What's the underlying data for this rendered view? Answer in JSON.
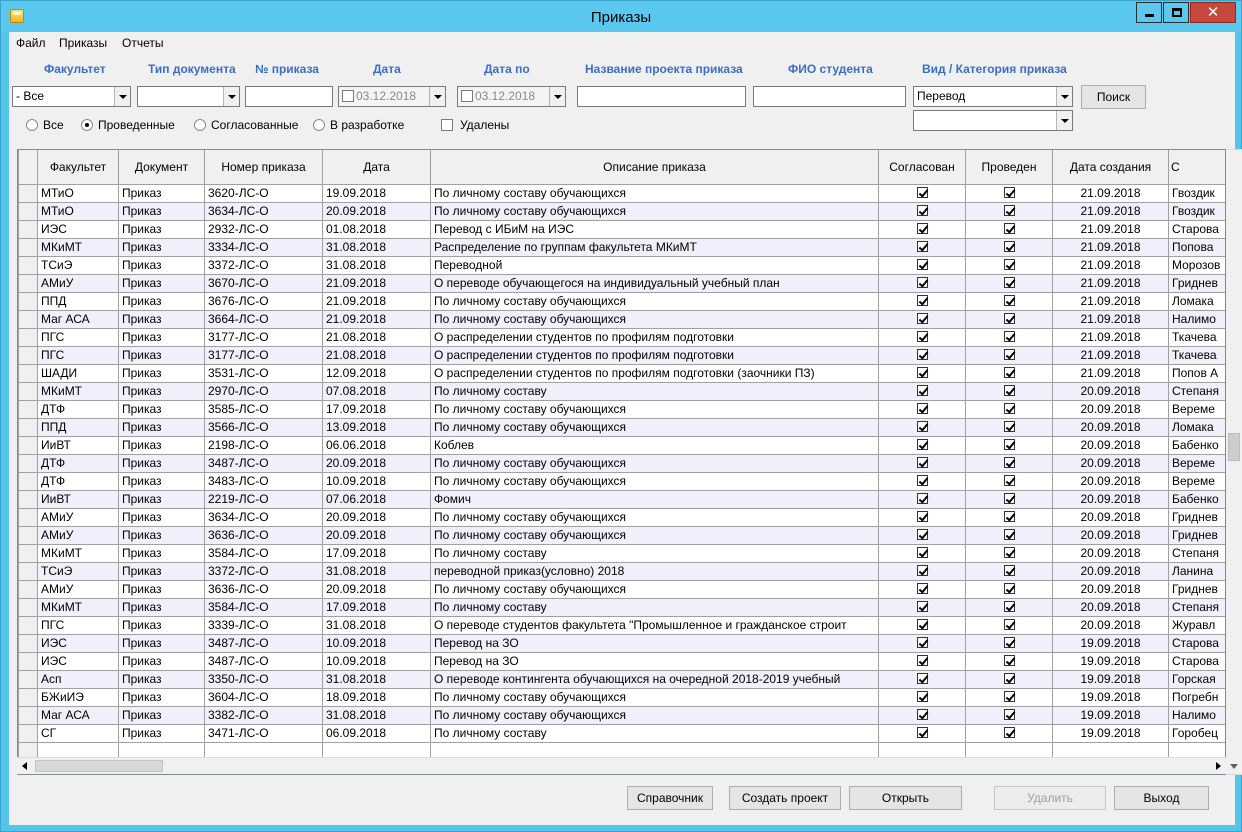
{
  "window": {
    "title": "Приказы"
  },
  "menu": [
    "Файл",
    "Приказы",
    "Отчеты"
  ],
  "filters": {
    "labels": {
      "faculty": "Факультет",
      "doc_type": "Тип документа",
      "order_no": "№ приказа",
      "date": "Дата",
      "date_to": "Дата по",
      "project_name": "Название проекта приказа",
      "student_name": "ФИО студента",
      "category": "Вид / Категория приказа"
    },
    "faculty_value": "- Все",
    "doc_type_value": "",
    "order_no_value": "",
    "date_value": "03.12.2018",
    "date_to_value": "03.12.2018",
    "project_name_value": "",
    "student_name_value": "",
    "category_value": "Перевод",
    "subcategory_value": "",
    "search_button": "Поиск"
  },
  "status_filter": {
    "options": [
      "Все",
      "Проведенные",
      "Согласованные",
      "В разработке"
    ],
    "selected": "Проведенные",
    "deleted_label": "Удалены"
  },
  "table": {
    "columns": [
      "Факультет",
      "Документ",
      "Номер приказа",
      "Дата",
      "Описание приказа",
      "Согласован",
      "Проведен",
      "Дата создания",
      "С"
    ],
    "rows": [
      [
        "МТиО",
        "Приказ",
        "3620-ЛС-О",
        "19.09.2018",
        "По личному составу обучающихся",
        true,
        true,
        "21.09.2018",
        "Гвоздик"
      ],
      [
        "МТиО",
        "Приказ",
        "3634-ЛС-О",
        "20.09.2018",
        "По личному составу обучающихся",
        true,
        true,
        "21.09.2018",
        "Гвоздик"
      ],
      [
        "ИЭС",
        "Приказ",
        "2932-ЛС-О",
        "01.08.2018",
        "Перевод с ИБиМ на ИЭС",
        true,
        true,
        "21.09.2018",
        "Старова"
      ],
      [
        "МКиМТ",
        "Приказ",
        "3334-ЛС-О",
        "31.08.2018",
        "Распределение по группам факультета МКиМТ",
        true,
        true,
        "21.09.2018",
        "Попова"
      ],
      [
        "ТСиЭ",
        "Приказ",
        "3372-ЛС-О",
        "31.08.2018",
        "Переводной",
        true,
        true,
        "21.09.2018",
        "Морозов"
      ],
      [
        "АМиУ",
        "Приказ",
        "3670-ЛС-О",
        "21.09.2018",
        "О переводе обучающегося на индивидуальный учебный план",
        true,
        true,
        "21.09.2018",
        "Гриднев"
      ],
      [
        "ППД",
        "Приказ",
        "3676-ЛС-О",
        "21.09.2018",
        "По личному составу обучающихся",
        true,
        true,
        "21.09.2018",
        "Ломака"
      ],
      [
        "Маг АСА",
        "Приказ",
        "3664-ЛС-О",
        "21.09.2018",
        "По личному составу обучающихся",
        true,
        true,
        "21.09.2018",
        "Налимо"
      ],
      [
        "ПГС",
        "Приказ",
        "3177-ЛС-О",
        "21.08.2018",
        "О распределении студентов по профилям подготовки",
        true,
        true,
        "21.09.2018",
        "Ткачева"
      ],
      [
        "ПГС",
        "Приказ",
        "3177-ЛС-О",
        "21.08.2018",
        "О распределении студентов по профилям подготовки",
        true,
        true,
        "21.09.2018",
        "Ткачева"
      ],
      [
        "ШАДИ",
        "Приказ",
        "3531-ЛС-О",
        "12.09.2018",
        "О распределении студентов по профилям подготовки (заочники ПЗ)",
        true,
        true,
        "21.09.2018",
        "Попов А"
      ],
      [
        "МКиМТ",
        "Приказ",
        "2970-ЛС-О",
        "07.08.2018",
        "По личному составу",
        true,
        true,
        "20.09.2018",
        "Степаня"
      ],
      [
        "ДТФ",
        "Приказ",
        "3585-ЛС-О",
        "17.09.2018",
        "По личному составу обучающихся",
        true,
        true,
        "20.09.2018",
        "Вереме"
      ],
      [
        "ППД",
        "Приказ",
        "3566-ЛС-О",
        "13.09.2018",
        "По личному составу обучающихся",
        true,
        true,
        "20.09.2018",
        "Ломака"
      ],
      [
        "ИиВТ",
        "Приказ",
        "2198-ЛС-О",
        "06.06.2018",
        "Коблев",
        true,
        true,
        "20.09.2018",
        "Бабенко"
      ],
      [
        "ДТФ",
        "Приказ",
        "3487-ЛС-О",
        "20.09.2018",
        "По личному составу обучающихся",
        true,
        true,
        "20.09.2018",
        "Вереме"
      ],
      [
        "ДТФ",
        "Приказ",
        "3483-ЛС-О",
        "10.09.2018",
        "По личному составу обучающихся",
        true,
        true,
        "20.09.2018",
        "Вереме"
      ],
      [
        "ИиВТ",
        "Приказ",
        "2219-ЛС-О",
        "07.06.2018",
        "Фомич",
        true,
        true,
        "20.09.2018",
        "Бабенко"
      ],
      [
        "АМиУ",
        "Приказ",
        "3634-ЛС-О",
        "20.09.2018",
        "По личному составу обучающихся",
        true,
        true,
        "20.09.2018",
        "Гриднев"
      ],
      [
        "АМиУ",
        "Приказ",
        "3636-ЛС-О",
        "20.09.2018",
        "По личному составу обучающихся",
        true,
        true,
        "20.09.2018",
        "Гриднев"
      ],
      [
        "МКиМТ",
        "Приказ",
        "3584-ЛС-О",
        "17.09.2018",
        "По личному составу",
        true,
        true,
        "20.09.2018",
        "Степаня"
      ],
      [
        "ТСиЭ",
        "Приказ",
        "3372-ЛС-О",
        "31.08.2018",
        "переводной приказ(условно) 2018",
        true,
        true,
        "20.09.2018",
        "Ланина"
      ],
      [
        "АМиУ",
        "Приказ",
        "3636-ЛС-О",
        "20.09.2018",
        "По личному составу обучающихся",
        true,
        true,
        "20.09.2018",
        "Гриднев"
      ],
      [
        "МКиМТ",
        "Приказ",
        "3584-ЛС-О",
        "17.09.2018",
        "По личному составу",
        true,
        true,
        "20.09.2018",
        "Степаня"
      ],
      [
        "ПГС",
        "Приказ",
        "3339-ЛС-О",
        "31.08.2018",
        "О переводе студентов факультета \"Промышленное и гражданское строит",
        true,
        true,
        "20.09.2018",
        "Журавл"
      ],
      [
        "ИЭС",
        "Приказ",
        "3487-ЛС-О",
        "10.09.2018",
        "Перевод на ЗО",
        true,
        true,
        "19.09.2018",
        "Старова"
      ],
      [
        "ИЭС",
        "Приказ",
        "3487-ЛС-О",
        "10.09.2018",
        "Перевод на ЗО",
        true,
        true,
        "19.09.2018",
        "Старова"
      ],
      [
        "Асп",
        "Приказ",
        "3350-ЛС-О",
        "31.08.2018",
        "О переводе контингента обучающихся на очередной 2018-2019 учебный",
        true,
        true,
        "19.09.2018",
        "Горская"
      ],
      [
        "БЖиИЭ",
        "Приказ",
        "3604-ЛС-О",
        "18.09.2018",
        "По личному составу обучающихся",
        true,
        true,
        "19.09.2018",
        "Погребн"
      ],
      [
        "Маг АСА",
        "Приказ",
        "3382-ЛС-О",
        "31.08.2018",
        "По личному составу обучающихся",
        true,
        true,
        "19.09.2018",
        "Налимо"
      ],
      [
        "СГ",
        "Приказ",
        "3471-ЛС-О",
        "06.09.2018",
        "По личному составу",
        true,
        true,
        "19.09.2018",
        "Горобец"
      ]
    ]
  },
  "buttons": {
    "reference": "Справочник",
    "create_project": "Создать проект",
    "open": "Открыть",
    "delete": "Удалить",
    "exit": "Выход"
  },
  "colors": {
    "titlebar": "#5bc8ef",
    "label_blue": "#3a6fc4",
    "alt_row": "#f0effa",
    "close_button": "#c7483d"
  }
}
